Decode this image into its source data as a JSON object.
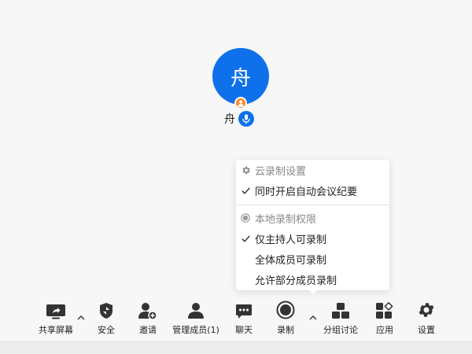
{
  "participant": {
    "avatar_initial": "舟",
    "name": "舟"
  },
  "record_menu": {
    "cloud_header": "云录制设置",
    "cloud_option": "同时开启自动会议纪要",
    "local_header": "本地录制权限",
    "local_options": [
      {
        "label": "仅主持人可录制",
        "checked": true
      },
      {
        "label": "全体成员可录制",
        "checked": false
      },
      {
        "label": "允许部分成员录制",
        "checked": false
      }
    ]
  },
  "toolbar": {
    "share": "共享屏幕",
    "security": "安全",
    "invite": "邀请",
    "members": "管理成员(1)",
    "chat": "聊天",
    "record": "录制",
    "breakout": "分组讨论",
    "apps": "应用",
    "settings": "设置"
  },
  "colors": {
    "accent": "#0e71eb",
    "host_badge": "#ff8a2a",
    "icon_dark": "#333333"
  }
}
